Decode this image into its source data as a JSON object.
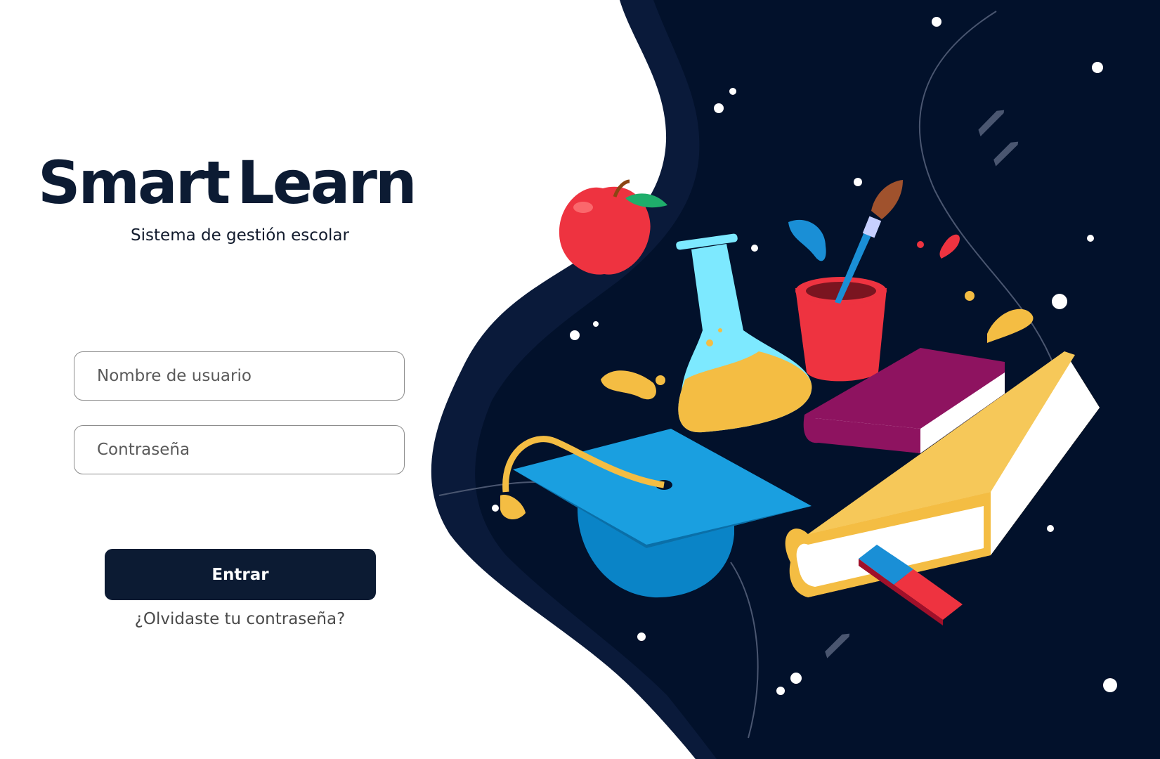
{
  "brand": {
    "name_part1": "Smart",
    "name_part2": "Learn",
    "subtitle": "Sistema de gestión escolar"
  },
  "login": {
    "username_placeholder": "Nombre de usuario",
    "password_placeholder": "Contraseña",
    "submit_label": "Entrar",
    "forgot_label": "¿Olvidaste tu contraseña?"
  },
  "colors": {
    "primary": "#0c1b33",
    "background_dark": "#02112b",
    "accent_yellow": "#f4bd43",
    "accent_blue": "#0a84c7",
    "accent_red": "#ee3340",
    "accent_purple": "#8e1360"
  },
  "illustration": {
    "items": [
      "apple-icon",
      "flask-icon",
      "paint-cup-icon",
      "paintbrush-icon",
      "purple-book-icon",
      "yellow-book-icon",
      "graduation-cap-icon",
      "eraser-icon"
    ]
  }
}
